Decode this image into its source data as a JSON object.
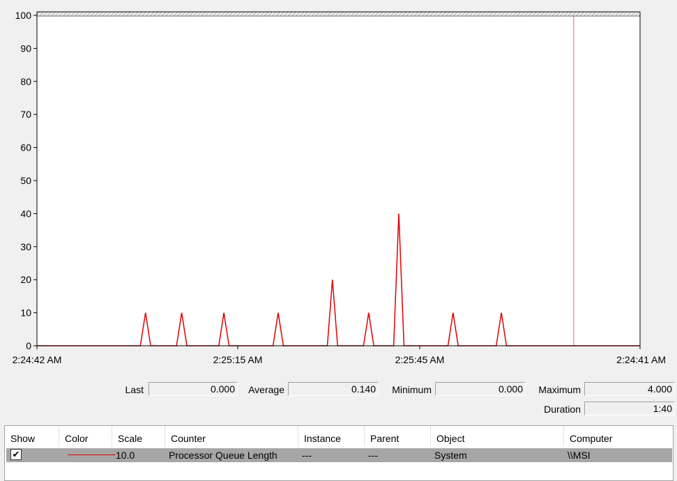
{
  "chart_data": {
    "type": "line",
    "ylim": [
      0,
      100
    ],
    "y_ticks": [
      "0",
      "10",
      "20",
      "30",
      "40",
      "50",
      "60",
      "70",
      "80",
      "90",
      "100"
    ],
    "x_tick_labels": [
      "2:24:42 AM",
      "2:25:15 AM",
      "2:25:45 AM",
      "2:24:41 AM"
    ],
    "x_range_seconds": 100,
    "grid": false,
    "series": [
      {
        "name": "Processor Queue Length",
        "color": "#e00000",
        "scale": 10.0,
        "raw_spikes": [
          {
            "t": 18,
            "v": 1
          },
          {
            "t": 24,
            "v": 1
          },
          {
            "t": 31,
            "v": 1
          },
          {
            "t": 40,
            "v": 1
          },
          {
            "t": 49,
            "v": 2
          },
          {
            "t": 55,
            "v": 1
          },
          {
            "t": 60,
            "v": 4
          },
          {
            "t": 69,
            "v": 1
          },
          {
            "t": 77,
            "v": 1
          }
        ]
      }
    ],
    "current_time_marker_seconds": 89
  },
  "stats": {
    "last_label": "Last",
    "last_value": "0.000",
    "average_label": "Average",
    "average_value": "0.140",
    "minimum_label": "Minimum",
    "minimum_value": "0.000",
    "maximum_label": "Maximum",
    "maximum_value": "4.000",
    "duration_label": "Duration",
    "duration_value": "1:40"
  },
  "table": {
    "headers": {
      "show": "Show",
      "color": "Color",
      "scale": "Scale",
      "counter": "Counter",
      "instance": "Instance",
      "parent": "Parent",
      "object": "Object",
      "computer": "Computer"
    },
    "row": {
      "show": true,
      "color": "#e00000",
      "scale": "10.0",
      "counter": "Processor Queue Length",
      "instance": "---",
      "parent": "---",
      "object": "System",
      "computer": "\\\\MSI"
    }
  }
}
